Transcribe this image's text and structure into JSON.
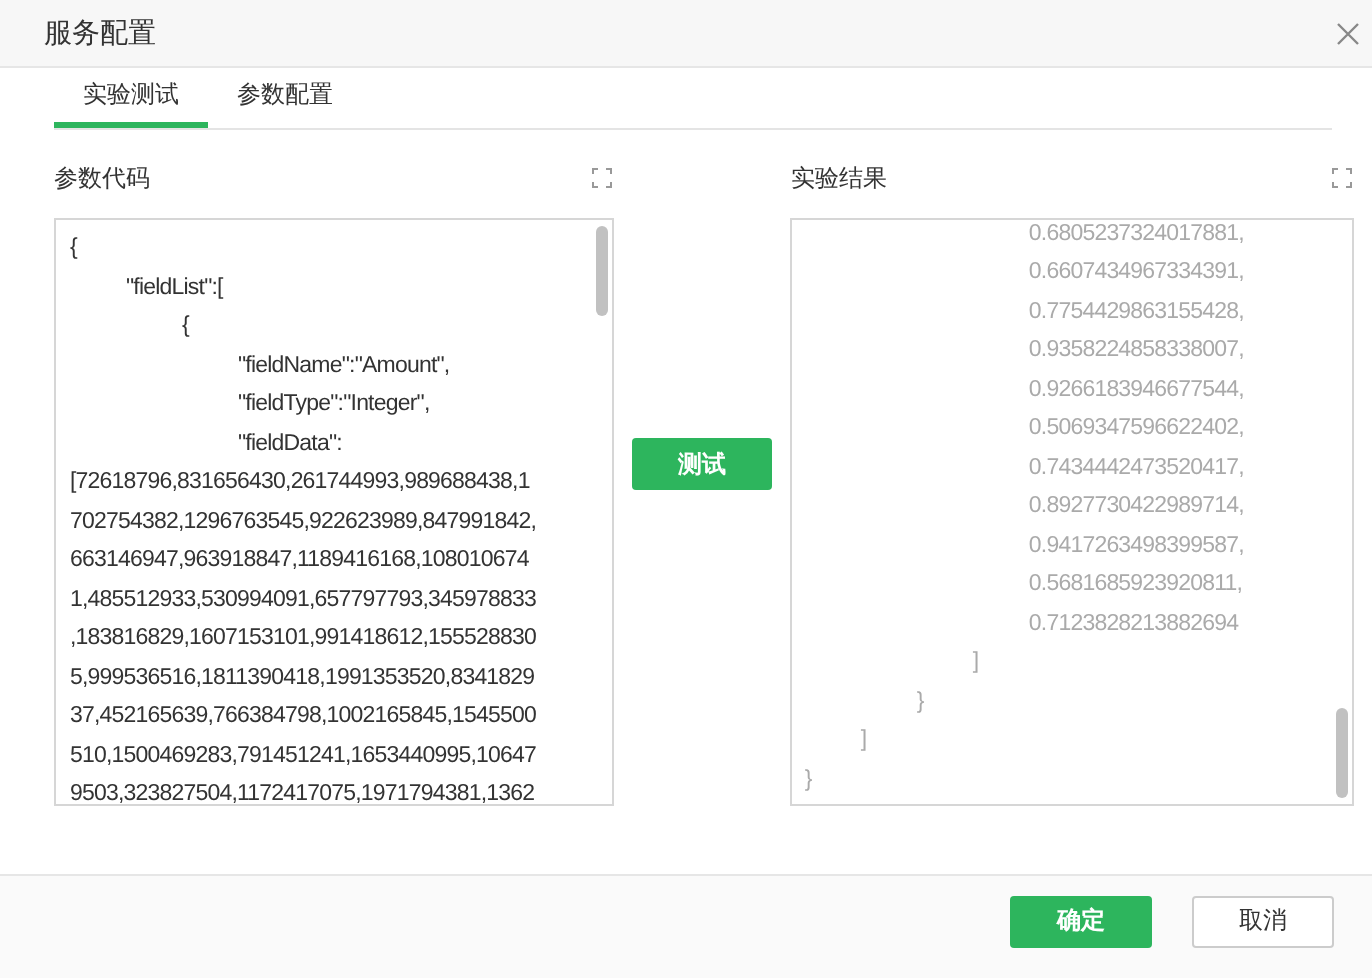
{
  "window": {
    "title": "服务配置"
  },
  "tabs": [
    {
      "label": "实验测试",
      "selected": true
    },
    {
      "label": "参数配置",
      "selected": false
    }
  ],
  "code_panel": {
    "label": "参数代码",
    "lines": [
      "{",
      "\t\"fieldList\":[",
      "\t\t{",
      "\t\t\t\"fieldName\":\"Amount\",",
      "\t\t\t\"fieldType\":\"Integer\",",
      "\t\t\t\"fieldData\":",
      "[72618796,831656430,261744993,989688438,1",
      "702754382,1296763545,922623989,847991842,",
      "663146947,963918847,1189416168,108010674",
      "1,485512933,530994091,657797793,345978833",
      ",183816829,1607153101,991418612,155528830",
      "5,999536516,1811390418,1991353520,8341829",
      "37,452165639,766384798,1002165845,1545500",
      "510,1500469283,791451241,1653440995,10647",
      "9503,323827504,1172417075,1971794381,1362"
    ]
  },
  "test_button": {
    "label": "测试"
  },
  "result_panel": {
    "label": "实验结果",
    "lines": [
      "\t\t\t\t0.6805237324017881,",
      "\t\t\t\t0.6607434967334391,",
      "\t\t\t\t0.7754429863155428,",
      "\t\t\t\t0.9358224858338007,",
      "\t\t\t\t0.9266183946677544,",
      "\t\t\t\t0.5069347596622402,",
      "\t\t\t\t0.7434442473520417,",
      "\t\t\t\t0.8927730422989714,",
      "\t\t\t\t0.9417263498399587,",
      "\t\t\t\t0.5681685923920811,",
      "\t\t\t\t0.7123828213882694",
      "\t\t\t]",
      "\t\t}",
      "\t]",
      "}"
    ]
  },
  "buttons": [
    {
      "label": "确定",
      "kind": "primary"
    },
    {
      "label": "取消",
      "kind": "secondary"
    }
  ]
}
